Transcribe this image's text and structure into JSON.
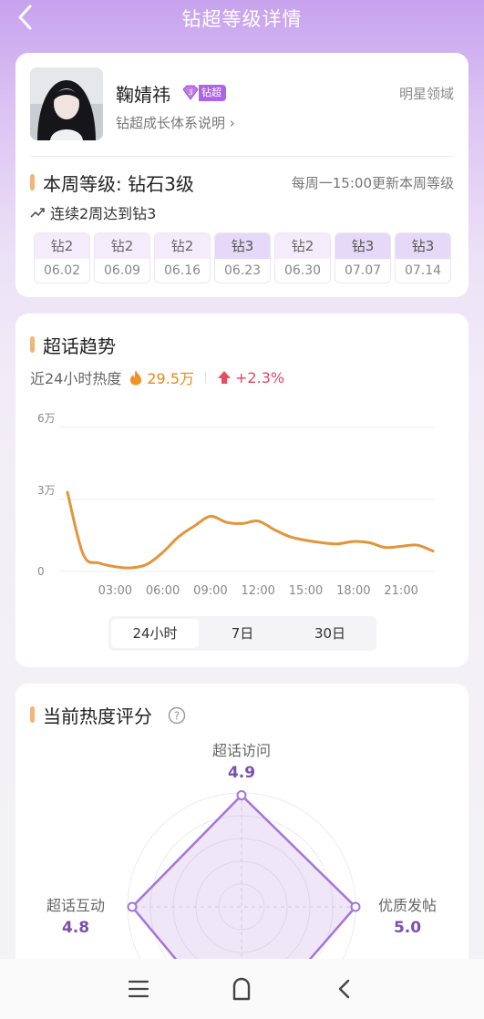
{
  "header": {
    "title": "钻超等级详情"
  },
  "profile": {
    "name": "鞠婧祎",
    "badge": "钻超",
    "badge_level": "3",
    "system_link": "钻超成长体系说明 ›",
    "domain": "明星领域",
    "level_title": "本周等级: 钻石3级",
    "update_note": "每周一15:00更新本周等级",
    "streak": "连续2周达到钻3",
    "weeks": [
      {
        "level": "钻2",
        "date": "06.02"
      },
      {
        "level": "钻2",
        "date": "06.09"
      },
      {
        "level": "钻2",
        "date": "06.16"
      },
      {
        "level": "钻3",
        "date": "06.23"
      },
      {
        "level": "钻2",
        "date": "06.30"
      },
      {
        "level": "钻3",
        "date": "07.07"
      },
      {
        "level": "钻3",
        "date": "07.14"
      }
    ]
  },
  "trend": {
    "title": "超话趋势",
    "heat_label": "近24小时热度",
    "heat_value": "29.5万",
    "change": "+2.3%",
    "tabs": [
      "24小时",
      "7日",
      "30日"
    ],
    "active_tab": "24小时"
  },
  "chart_data": {
    "type": "line",
    "x": [
      "00:00",
      "01:00",
      "02:00",
      "03:00",
      "04:00",
      "05:00",
      "06:00",
      "07:00",
      "08:00",
      "09:00",
      "10:00",
      "11:00",
      "12:00",
      "13:00",
      "14:00",
      "15:00",
      "16:00",
      "17:00",
      "18:00",
      "19:00",
      "20:00",
      "21:00",
      "22:00",
      "23:00"
    ],
    "xticks": [
      "03:00",
      "06:00",
      "09:00",
      "12:00",
      "15:00",
      "18:00",
      "21:00"
    ],
    "yticks": [
      "0",
      "3万",
      "6万"
    ],
    "ylim": [
      0,
      60000
    ],
    "color": "#e3953a",
    "series": [
      {
        "values": [
          33000,
          7000,
          3500,
          2000,
          1500,
          3000,
          8000,
          14500,
          19000,
          23000,
          20500,
          20000,
          21000,
          17500,
          14500,
          13000,
          12000,
          11500,
          12500,
          12000,
          10000,
          10500,
          11000,
          8500
        ]
      }
    ]
  },
  "score": {
    "title": "当前热度评分",
    "help_icon": "question-icon",
    "axes": [
      {
        "label": "超话访问",
        "value": "4.9"
      },
      {
        "label": "优质发帖",
        "value": "5.0"
      },
      {
        "label": "超话互动",
        "value": "4.8"
      }
    ],
    "color": "#a474d8"
  },
  "navbar": {
    "icons": [
      "menu-icon",
      "home-icon",
      "back-icon"
    ]
  }
}
